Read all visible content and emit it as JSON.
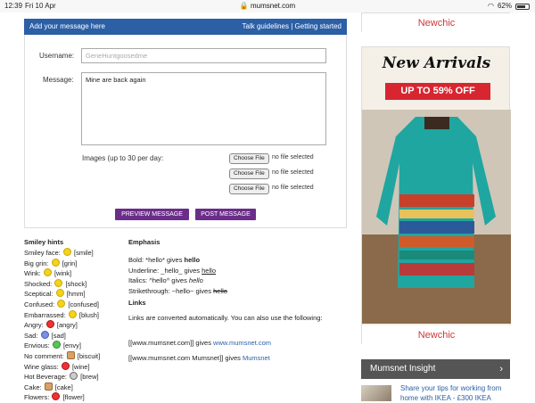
{
  "status_bar": {
    "time": "12:39",
    "date": "Fri 10 Apr",
    "url": "mumsnet.com",
    "battery": "62%"
  },
  "header": {
    "title": "Add your message here",
    "links": "Talk guidelines | Getting started"
  },
  "form": {
    "username_label": "Username:",
    "username_placeholder": "GeneHuntgoosedme",
    "message_label": "Message:",
    "message_value": "Mine are back again",
    "images_label": "Images (up to 30 per day:",
    "choose_file": "Choose File",
    "no_file": "no file selected",
    "preview_label": "PREVIEW MESSAGE",
    "post_label": "POST MESSAGE"
  },
  "smiley_hints": {
    "title": "Smiley hints",
    "items": [
      {
        "name": "Smiley face:",
        "code": "[smile]",
        "icon": "smile-icon"
      },
      {
        "name": "Big grin:",
        "code": "[grin]",
        "icon": "grin-icon"
      },
      {
        "name": "Wink:",
        "code": "[wink]",
        "icon": "wink-icon"
      },
      {
        "name": "Shocked:",
        "code": "[shock]",
        "icon": "shock-icon"
      },
      {
        "name": "Sceptical:",
        "code": "[hmm]",
        "icon": "hmm-icon"
      },
      {
        "name": "Confused:",
        "code": "[confused]",
        "icon": "confused-icon"
      },
      {
        "name": "Embarrassed:",
        "code": "[blush]",
        "icon": "blush-icon"
      },
      {
        "name": "Angry:",
        "code": "[angry]",
        "icon": "angry-icon"
      },
      {
        "name": "Sad:",
        "code": "[sad]",
        "icon": "sad-icon"
      },
      {
        "name": "Envious:",
        "code": "[envy]",
        "icon": "envy-icon"
      },
      {
        "name": "No comment:",
        "code": "[biscuit]",
        "icon": "biscuit-icon"
      },
      {
        "name": "Wine glass:",
        "code": "[wine]",
        "icon": "wine-icon"
      },
      {
        "name": "Hot Beverage:",
        "code": "[brew]",
        "icon": "brew-icon"
      },
      {
        "name": "Cake:",
        "code": "[cake]",
        "icon": "cake-icon"
      },
      {
        "name": "Flowers:",
        "code": "[flower]",
        "icon": "flower-icon"
      }
    ]
  },
  "emphasis": {
    "title": "Emphasis",
    "bold": {
      "pre": "Bold: *hello* gives ",
      "sample": "hello"
    },
    "underline": {
      "pre": "Underline: _hello_ gives ",
      "sample": "hello"
    },
    "italics": {
      "pre": "Italics: ^hello^ gives ",
      "sample": "hello"
    },
    "strike": {
      "pre": "Strikethrough: ~hello~ gives ",
      "sample": "hello"
    }
  },
  "links": {
    "title": "Links",
    "desc": "Links are converted automatically. You can also use the following:",
    "ex1_pre": "[[www.mumsnet.com]] gives ",
    "ex1_link": "www.mumsnet.com",
    "ex2_pre": "[[www.mumsnet.com Mumsnet]] gives ",
    "ex2_link": "Mumsnet"
  },
  "ads": {
    "brand": "Newchic",
    "new_arrivals": "New Arrivals",
    "promo": "UP TO 59% OFF"
  },
  "insight": {
    "title": "Mumsnet Insight",
    "link": "Share your tips for working from home with IKEA - £300 IKEA"
  }
}
